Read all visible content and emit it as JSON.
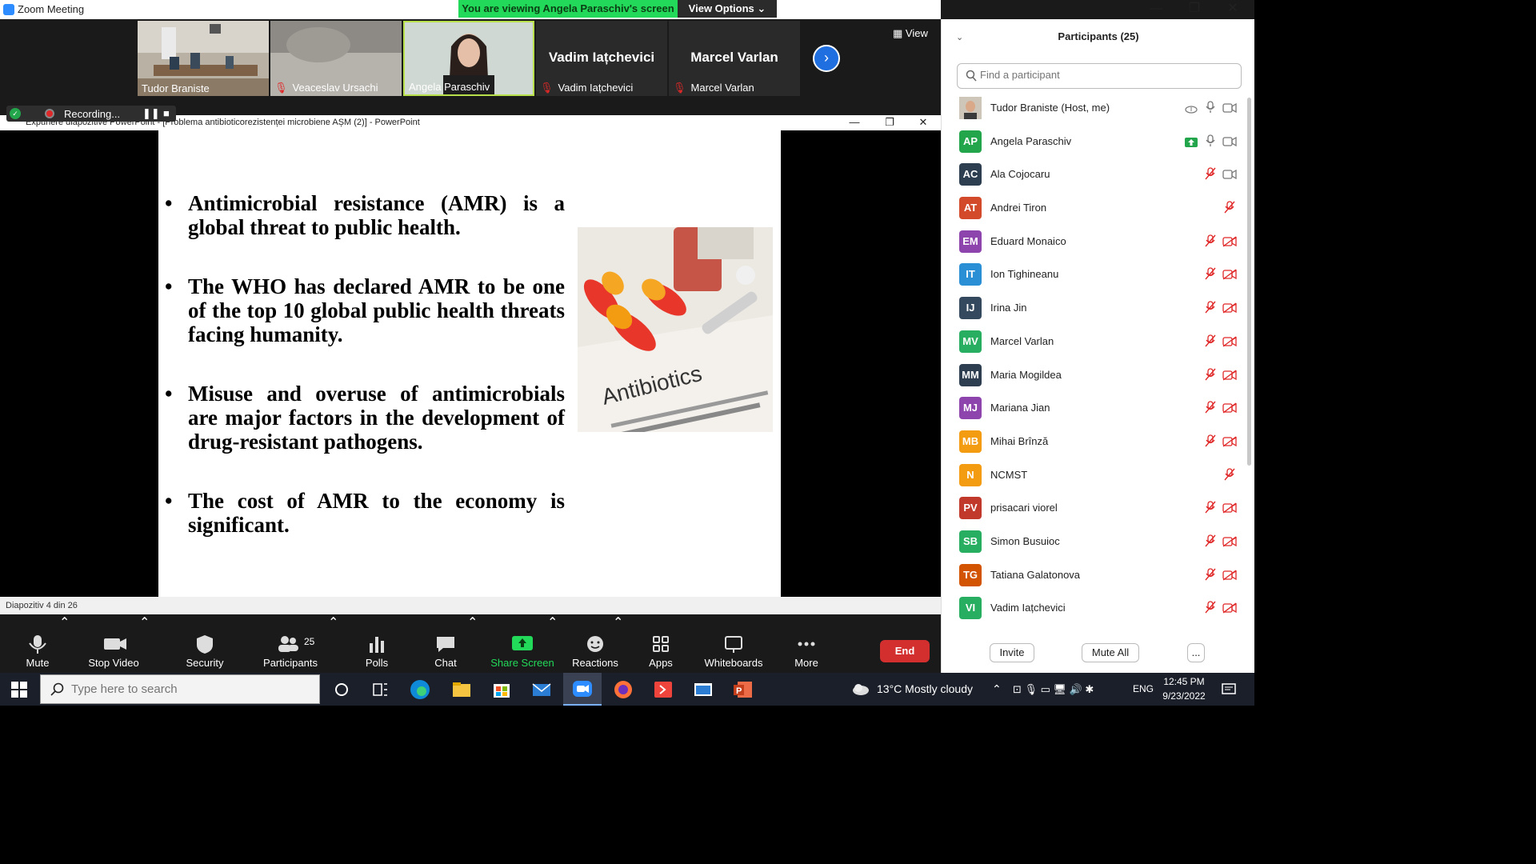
{
  "window": {
    "title": "Zoom Meeting"
  },
  "banner": {
    "viewing": "You are viewing Angela Paraschiv's screen",
    "view_options": "View Options"
  },
  "strip": {
    "view_label": "View",
    "thumbs": [
      {
        "name": "Tudor Braniste",
        "muted": false,
        "video": true
      },
      {
        "name": "Veaceslav Ursachi",
        "muted": true,
        "video": true
      },
      {
        "name": "Angela Paraschiv",
        "muted": false,
        "video": true
      },
      {
        "name": "Vadim Iațchevici",
        "muted": true,
        "video": false
      },
      {
        "name": "Marcel Varlan",
        "muted": true,
        "video": false
      }
    ]
  },
  "recording": {
    "label": "Recording..."
  },
  "ppt": {
    "title": "Expunere diapozitive PowerPoint - [Problema antibioticorezistenței microbiene AȘM (2)] - PowerPoint",
    "status": "Diapozitiv 4 din 26",
    "bullets": [
      "Antimicrobial resistance (AMR) is a global threat to public health.",
      "The WHO has declared AMR to be one of the top 10 global public health threats facing humanity.",
      "Misuse and overuse of antimicrobials are major factors in the development of drug-resistant pathogens.",
      "The cost of AMR to the economy is significant."
    ],
    "image_text": "Antibiotics"
  },
  "toolbar": {
    "mute": "Mute",
    "stop_video": "Stop Video",
    "security": "Security",
    "participants": "Participants",
    "participants_count": "25",
    "polls": "Polls",
    "chat": "Chat",
    "share_screen": "Share Screen",
    "reactions": "Reactions",
    "apps": "Apps",
    "whiteboards": "Whiteboards",
    "more": "More",
    "end": "End"
  },
  "panel": {
    "title": "Participants (25)",
    "search_placeholder": "Find a participant",
    "invite": "Invite",
    "mute_all": "Mute All",
    "more": "...",
    "participants": [
      {
        "initials": "",
        "name": "Tudor Braniste (Host, me)",
        "color": "#7a6a5a",
        "photo": true,
        "share": false,
        "mic": "on",
        "video": "on"
      },
      {
        "initials": "AP",
        "name": "Angela Paraschiv",
        "color": "#23a54b",
        "share": true,
        "mic": "on",
        "video": "on"
      },
      {
        "initials": "AC",
        "name": "Ala Cojocaru",
        "color": "#2c3e50",
        "share": false,
        "mic": "muted",
        "video": "on"
      },
      {
        "initials": "AT",
        "name": "Andrei Tiron",
        "color": "#d24a2a",
        "share": false,
        "mic": "muted",
        "video": "none"
      },
      {
        "initials": "EM",
        "name": "Eduard Monaico",
        "color": "#8e44ad",
        "share": false,
        "mic": "muted",
        "video": "off"
      },
      {
        "initials": "IT",
        "name": "Ion Tighineanu",
        "color": "#2b8fd6",
        "share": false,
        "mic": "muted",
        "video": "off"
      },
      {
        "initials": "IJ",
        "name": "Irina Jin",
        "color": "#34495e",
        "share": false,
        "mic": "muted",
        "video": "off"
      },
      {
        "initials": "MV",
        "name": "Marcel Varlan",
        "color": "#27ae60",
        "share": false,
        "mic": "muted",
        "video": "off"
      },
      {
        "initials": "MM",
        "name": "Maria Mogildea",
        "color": "#2c3e50",
        "share": false,
        "mic": "muted",
        "video": "off"
      },
      {
        "initials": "MJ",
        "name": "Mariana Jian",
        "color": "#8e44ad",
        "share": false,
        "mic": "muted",
        "video": "off"
      },
      {
        "initials": "MB",
        "name": "Mihai Brînză",
        "color": "#f39c12",
        "share": false,
        "mic": "muted",
        "video": "off"
      },
      {
        "initials": "N",
        "name": "NCMST",
        "color": "#f39c12",
        "share": false,
        "mic": "muted",
        "video": "none"
      },
      {
        "initials": "PV",
        "name": "prisacari viorel",
        "color": "#c0392b",
        "share": false,
        "mic": "muted",
        "video": "off"
      },
      {
        "initials": "SB",
        "name": "Simon Busuioc",
        "color": "#27ae60",
        "share": false,
        "mic": "muted",
        "video": "off"
      },
      {
        "initials": "TG",
        "name": "Tatiana Galatonova",
        "color": "#d35400",
        "share": false,
        "mic": "muted",
        "video": "off"
      },
      {
        "initials": "VI",
        "name": "Vadim Iațchevici",
        "color": "#27ae60",
        "share": false,
        "mic": "muted",
        "video": "off"
      }
    ]
  },
  "taskbar": {
    "search_placeholder": "Type here to search",
    "weather": "13°C  Mostly cloudy",
    "lang": "ENG",
    "time": "12:45 PM",
    "date": "9/23/2022"
  },
  "colors": {
    "accent": "#2d8cff",
    "green": "#23d959",
    "end_red": "#d42f2f",
    "muted_red": "#e02828"
  }
}
